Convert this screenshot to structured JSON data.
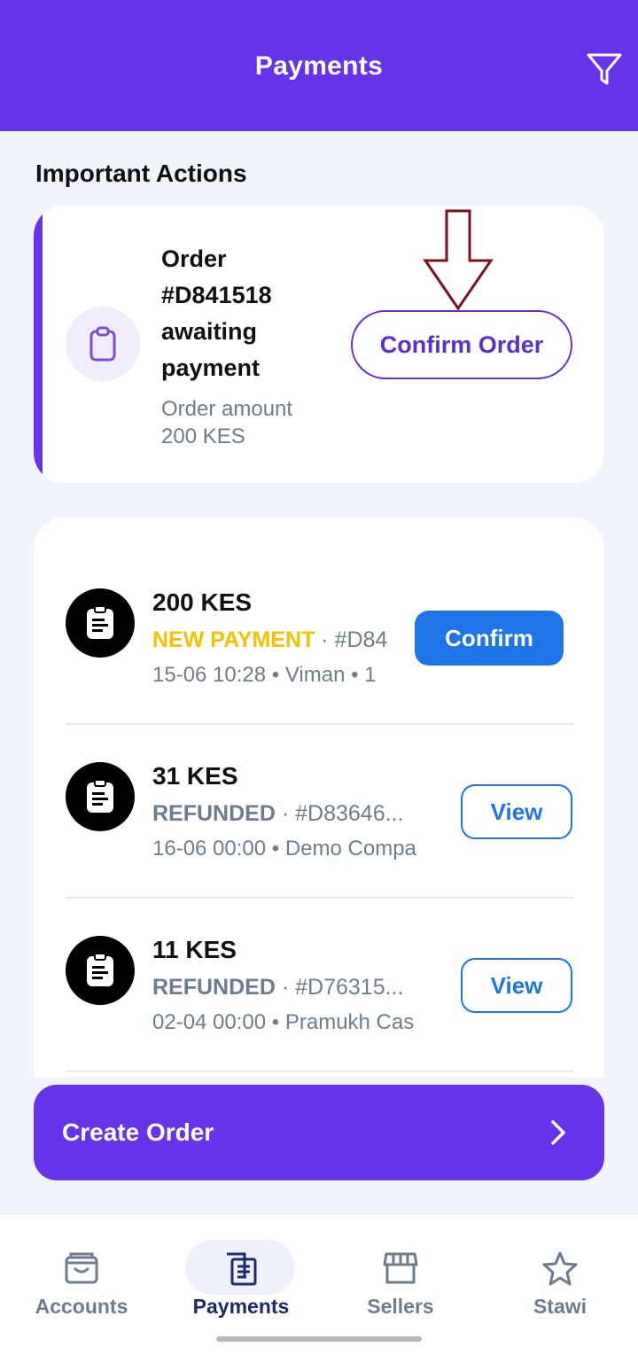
{
  "header": {
    "title": "Payments",
    "filter_icon": "filter-icon"
  },
  "important_actions": {
    "section_title": "Important Actions",
    "card": {
      "title": "Order #D841518 awaiting payment",
      "subtitle_line1": "Order amount",
      "subtitle_line2": "200 KES",
      "icon": "clipboard-icon",
      "button_label": "Confirm Order"
    }
  },
  "transactions": [
    {
      "amount": "200 KES",
      "status": "NEW PAYMENT",
      "ref": " · #D84",
      "meta": "15-06 10:28 • Viman  • 1",
      "action": "Confirm"
    },
    {
      "amount": "31 KES",
      "status": "REFUNDED",
      "ref": " · #D83646...",
      "meta": "16-06 00:00 • Demo Compa",
      "action": "View"
    },
    {
      "amount": "11 KES",
      "status": "REFUNDED",
      "ref": " · #D76315...",
      "meta": "02-04 00:00 • Pramukh Cas",
      "action": "View"
    }
  ],
  "create_order": {
    "label": "Create Order"
  },
  "bottom_nav": [
    {
      "label": "Accounts",
      "icon": "wallet-icon",
      "active": false
    },
    {
      "label": "Payments",
      "icon": "receipt-icon",
      "active": true
    },
    {
      "label": "Sellers",
      "icon": "store-icon",
      "active": false
    },
    {
      "label": "Stawi",
      "icon": "star-icon",
      "active": false
    }
  ],
  "colors": {
    "brand": "#6633ea",
    "primary_button": "#1f74e8",
    "new_payment": "#f3c200",
    "muted": "#6d7c90"
  }
}
